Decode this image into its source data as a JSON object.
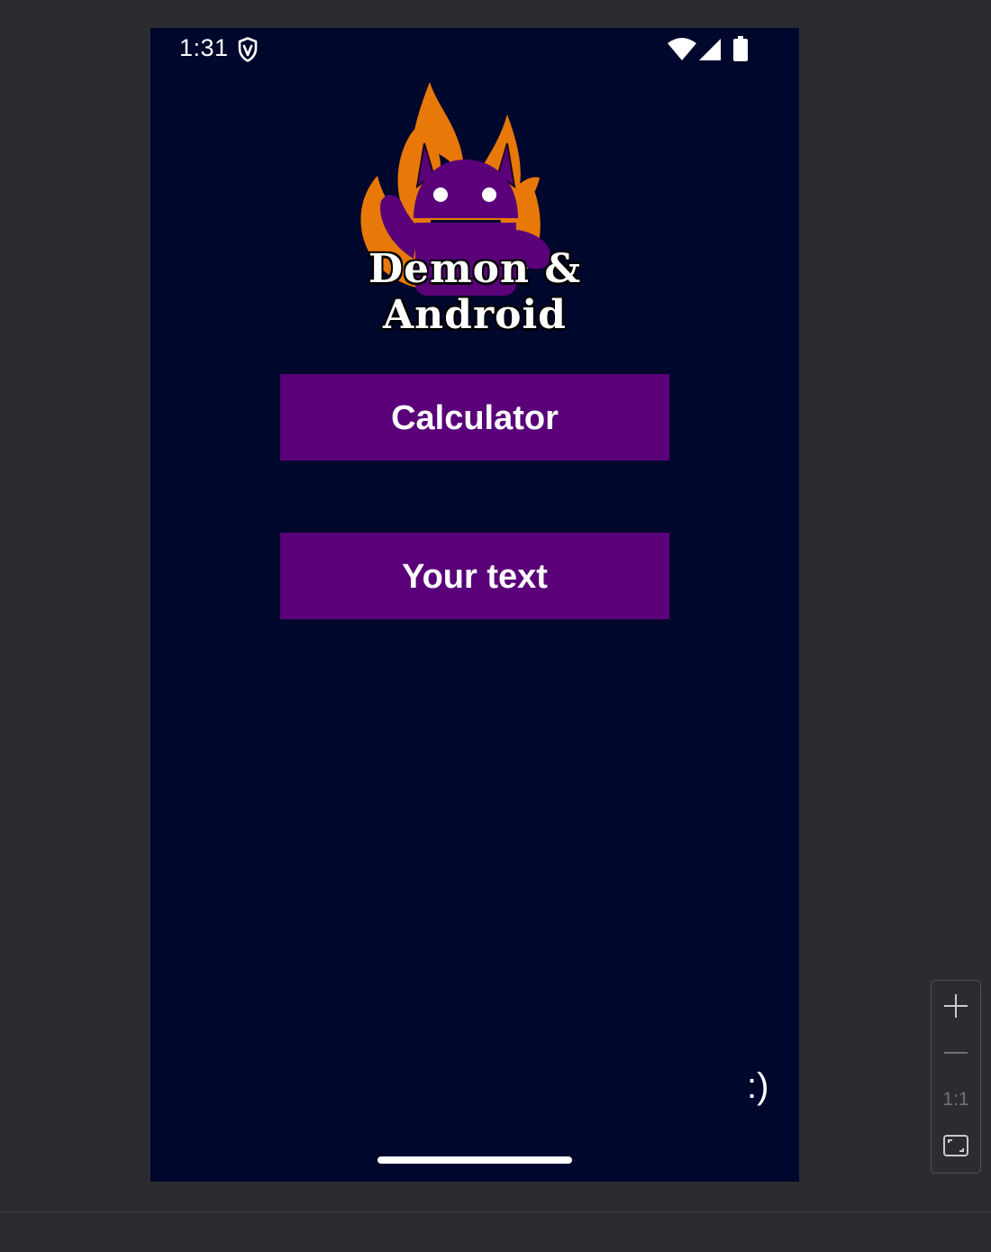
{
  "status_bar": {
    "time": "1:31",
    "icons": [
      "shield-icon",
      "wifi-icon",
      "cell-signal-icon",
      "battery-icon"
    ]
  },
  "logo": {
    "title": "Demon & Android",
    "icon": "flaming-demon-android-logo",
    "colors": {
      "flame": "#e87808",
      "robot": "#5a0079"
    }
  },
  "buttons": {
    "calculator": "Calculator",
    "your_text": "Your text"
  },
  "footer": {
    "smiley": ":)"
  },
  "zoom_controls": {
    "zoom_in_icon": "plus-icon",
    "zoom_out_icon": "minus-icon",
    "actual_size": "1:1",
    "fit_icon": "fit-screen-icon"
  },
  "colors": {
    "screen_background": "#00072d",
    "button_background": "#5a0079",
    "ide_background": "#2b2c2f"
  }
}
